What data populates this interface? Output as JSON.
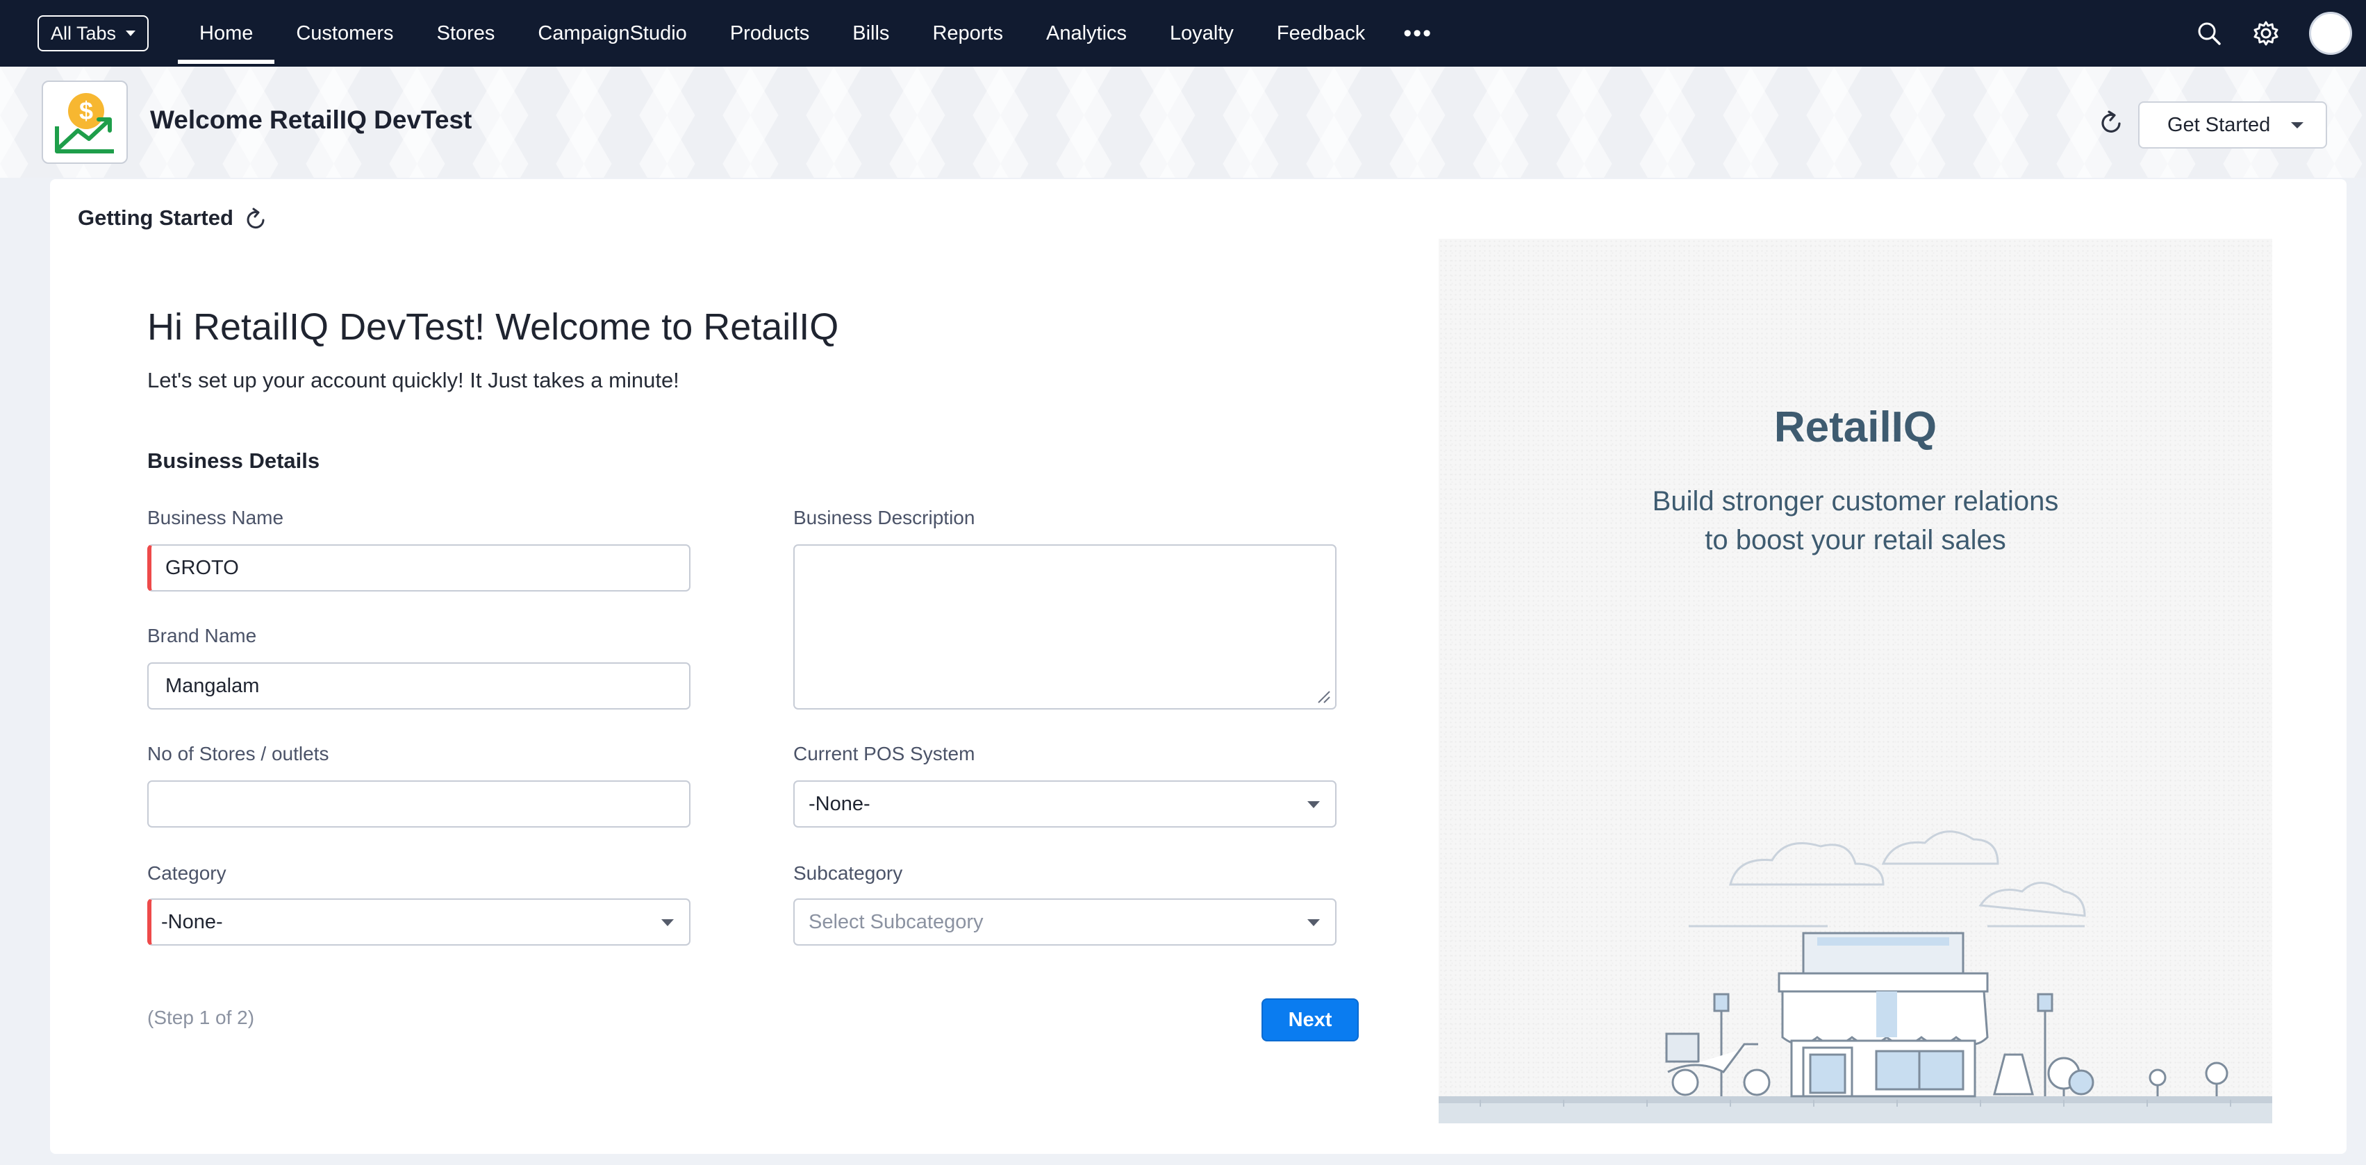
{
  "nav": {
    "all_tabs": "All Tabs",
    "tabs": [
      "Home",
      "Customers",
      "Stores",
      "CampaignStudio",
      "Products",
      "Bills",
      "Reports",
      "Analytics",
      "Loyalty",
      "Feedback"
    ],
    "active_tab": "Home",
    "more": "•••"
  },
  "header": {
    "welcome": "Welcome RetailIQ DevTest",
    "get_started": "Get Started"
  },
  "card": {
    "title": "Getting Started",
    "greeting": "Hi RetailIQ DevTest! Welcome to RetailIQ",
    "subtitle": "Let's set up your account quickly! It Just takes a minute!",
    "section": "Business Details",
    "fields": {
      "business_name": {
        "label": "Business Name",
        "value": "GROTO"
      },
      "business_description": {
        "label": "Business Description",
        "value": ""
      },
      "brand_name": {
        "label": "Brand Name",
        "value": "Mangalam"
      },
      "stores": {
        "label": "No of Stores / outlets",
        "value": ""
      },
      "pos": {
        "label": "Current POS System",
        "value": "-None-"
      },
      "category": {
        "label": "Category",
        "value": "-None-"
      },
      "subcategory": {
        "label": "Subcategory",
        "placeholder": "Select Subcategory"
      }
    },
    "step": "(Step 1 of 2)",
    "next": "Next"
  },
  "panel": {
    "brand": "RetailIQ",
    "tagline_1": "Build stronger customer relations",
    "tagline_2": "to boost your retail sales"
  },
  "colors": {
    "nav_bg": "#111b30",
    "primary": "#0a7cf0",
    "required": "#ee4a4a",
    "brand_text": "#3e5b70"
  }
}
